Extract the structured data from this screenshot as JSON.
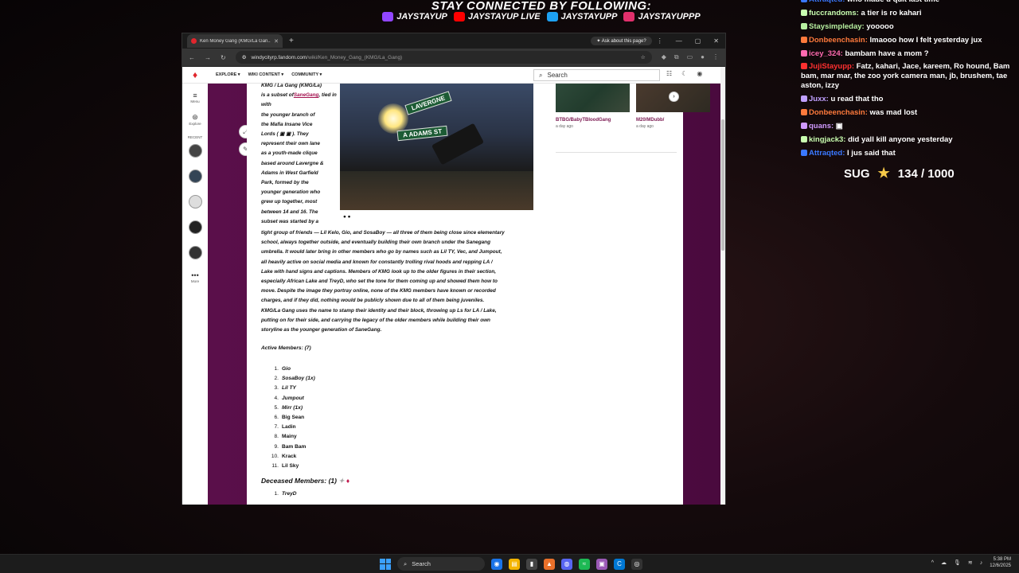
{
  "overlay": {
    "title": "STAY CONNECTED BY FOLLOWING:",
    "socials": [
      {
        "icon": "twitch-icon",
        "label": "JAYSTAYUP",
        "color": "#9146ff"
      },
      {
        "icon": "youtube-icon",
        "label": "JAYSTAYUP LIVE",
        "color": "#ff0000"
      },
      {
        "icon": "twitter-icon",
        "label": "JAYSTAYUPP",
        "color": "#1da1f2"
      },
      {
        "icon": "instagram-icon",
        "label": "JAYSTAYUPPP",
        "color": "#e1306c"
      }
    ]
  },
  "chat": [
    {
      "user": "Attraqted:",
      "msg": "who made u quit last time",
      "color": "#3a78ff"
    },
    {
      "user": "fuccrandoms:",
      "msg": "a tier is ro kahari",
      "color": "#c9ffb0"
    },
    {
      "user": "Staysimpleday:",
      "msg": "yooooo",
      "color": "#b7f0a0"
    },
    {
      "user": "Donbeenchasin:",
      "msg": "lmaooo how I felt yesterday jux",
      "color": "#ff7a3c"
    },
    {
      "user": "icey_324:",
      "msg": "bambam have a mom ?",
      "color": "#ff6ab0"
    },
    {
      "user": "JujiStayupp:",
      "msg": "Fatz, kahari, Jace, kareem, Ro hound, Bam bam, mar mar, the zoo york camera man, jb, brushem, tae aston, izzy",
      "color": "#ff3030"
    },
    {
      "user": "Juxx:",
      "msg": "u read that tho",
      "color": "#c0a0ff"
    },
    {
      "user": "Donbeenchasin:",
      "msg": "was mad lost",
      "color": "#ff7a3c"
    },
    {
      "user": "quans:",
      "msg": "▣",
      "color": "#d09aff"
    },
    {
      "user": "kingjack3:",
      "msg": "did yall kill anyone yesterday",
      "color": "#c9ffb0"
    },
    {
      "user": "Attraqted:",
      "msg": "I jus said that",
      "color": "#3a78ff"
    }
  ],
  "sug": {
    "label": "SUG",
    "value": "134 / 1000"
  },
  "browser": {
    "tab_title": "Ken Money Gang (KMG/La Gan...",
    "ask_label": "✦ Ask about this page?",
    "url_domain": "windycityrp.fandom.com",
    "url_path": "/wiki/Ken_Money_Gang_(KMG/La_Gang)"
  },
  "wiki": {
    "nav": [
      "EXPLORE ▾",
      "WIKI CONTENT ▾",
      "COMMUNITY ▾"
    ],
    "search_placeholder": "Search",
    "rail": {
      "menu": "Menu",
      "explore": "Explore",
      "recent": "RECENT",
      "more": "More"
    },
    "intro_lines": [
      "KMG / La Gang (KMG/La)",
      "is a subset of",
      "SaneGang",
      ", tied in with",
      "the younger branch of",
      "the Mafia Insane Vice",
      "Lords ( ▣ ▣ ). They",
      "represent their own lane",
      "as a youth-made clique",
      "based around Lavergne &",
      "Adams in West Garfield",
      "Park, formed by the",
      "younger generation who",
      "grew up together, most",
      "between 14 and 16. The",
      "subset was started by a"
    ],
    "paragraph_lines": [
      "tight group of friends — Lil Kelo, Gio, and SosaBoy — all three of them being close since elementary",
      "school, always together outside, and eventually building their own branch under the Sanegang",
      "umbrella. It would later bring in other members who go by names such as Lil TY, Vec, and Jumpout,",
      "all heavily active on social media and known for constantly trolling rival hoods and repping LA /",
      "Lake with hand signs and captions. Members of KMG look up to the older figures in their section,",
      "especially African Lake and TreyD, who set the tone for them coming up and showed them how to",
      "move. Despite the image they portray online, none of the KMG members have known or recorded",
      "charges, and if they did, nothing would be publicly shown due to all of them being juveniles.",
      "KMG/La Gang uses the name to stamp their identity and their block, throwing up Ls for LA / Lake,",
      "putting on for their side, and carrying the legacy of the older members while building their own",
      "storyline as the younger generation of SaneGang."
    ],
    "active_heading": "Active Members: (7)",
    "active_members": [
      {
        "n": "1.",
        "name": "Gio",
        "italic": true
      },
      {
        "n": "2.",
        "name": "SosaBoy (1x)",
        "italic": true
      },
      {
        "n": "3.",
        "name": "Lil TY",
        "italic": true
      },
      {
        "n": "4.",
        "name": "Jumpout",
        "italic": true
      },
      {
        "n": "5.",
        "name": "Mirr (1x)",
        "italic": true
      },
      {
        "n": "6.",
        "name": "Big Sean",
        "italic": false
      },
      {
        "n": "7.",
        "name": "Ladin",
        "italic": false
      },
      {
        "n": "8.",
        "name": "Mainy",
        "italic": false
      },
      {
        "n": "9.",
        "name": "Bam Bam",
        "italic": false
      },
      {
        "n": "10.",
        "name": "Krack",
        "italic": false
      },
      {
        "n": "11.",
        "name": "Lil Sky",
        "italic": false
      }
    ],
    "deceased_heading": "Deceased Members: (1)",
    "deceased_members": [
      {
        "n": "1.",
        "name": "TreyD"
      }
    ],
    "image_signs": [
      "LAVERGNE",
      "A ADAMS ST"
    ],
    "related": [
      {
        "caption": "BTBG/BabyTBloodGang",
        "time": "a day ago"
      },
      {
        "caption": "M20/MDubb/",
        "time": "a day ago"
      }
    ]
  },
  "taskbar": {
    "search": "Search",
    "time": "5:38 PM",
    "date": "12/6/2025"
  }
}
